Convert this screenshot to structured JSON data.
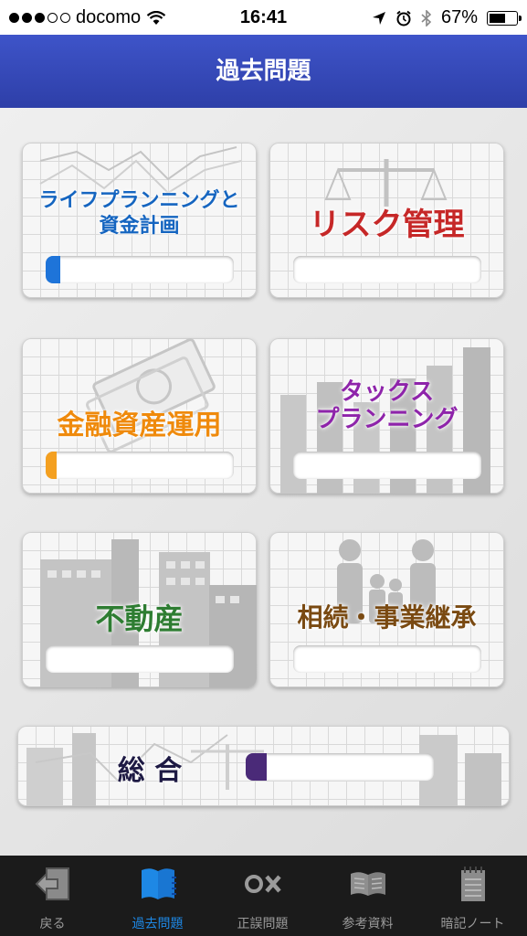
{
  "status_bar": {
    "carrier": "docomo",
    "time": "16:41",
    "battery": "67%",
    "battery_level": 0.67
  },
  "nav": {
    "title": "過去問題"
  },
  "cards": [
    {
      "title_line1": "ライフプランニングと",
      "title_line2": "資金計画",
      "color": "#1565c0",
      "progress": 0.08,
      "bar_color": "#1e74d9"
    },
    {
      "title": "リスク管理",
      "color": "#c62828",
      "progress": 0,
      "bar_color": "#c62828"
    },
    {
      "title": "金融資産運用",
      "color": "#ef8a0c",
      "progress": 0.06,
      "bar_color": "#f4a020"
    },
    {
      "title_line1": "タックス",
      "title_line2": "プランニング",
      "color": "#8e24aa",
      "progress": 0,
      "bar_color": "#8e24aa"
    },
    {
      "title": "不動産",
      "color": "#2e7d32",
      "progress": 0,
      "bar_color": "#2e7d32"
    },
    {
      "title": "相続・事業継承",
      "color": "#7a4a12",
      "progress": 0,
      "bar_color": "#7a4a12"
    }
  ],
  "overall": {
    "title": "総 合",
    "color": "#1e1a44",
    "progress": 0.11,
    "bar_color": "#4a2a78"
  },
  "tabs": [
    {
      "label": "戻る",
      "icon": "back-icon"
    },
    {
      "label": "過去問題",
      "icon": "book-icon",
      "active": true
    },
    {
      "label": "正誤問題",
      "icon": "ox-icon"
    },
    {
      "label": "参考資料",
      "icon": "open-book-icon"
    },
    {
      "label": "暗記ノート",
      "icon": "notepad-icon"
    }
  ]
}
